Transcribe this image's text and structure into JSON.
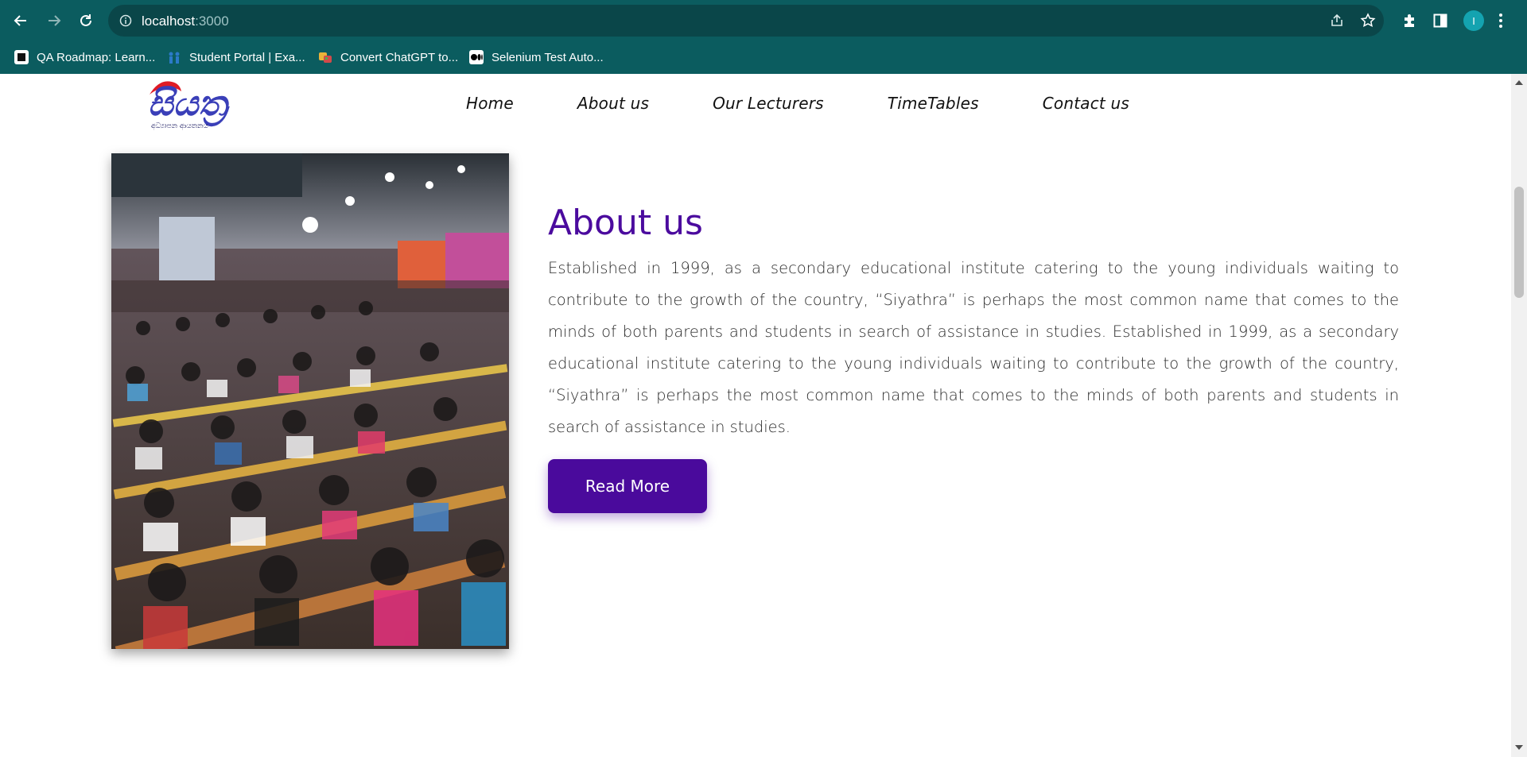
{
  "browser": {
    "url_host": "localhost",
    "url_port": ":3000",
    "profile_initial": "I",
    "bookmarks": [
      {
        "label": "QA Roadmap: Learn...",
        "icon": "roadmap-icon",
        "color": "#111111"
      },
      {
        "label": "Student Portal | Exa...",
        "icon": "students-icon",
        "color": "#1b6fb8"
      },
      {
        "label": "Convert ChatGPT to...",
        "icon": "convert-icon",
        "color": "#e9b33a"
      },
      {
        "label": "Selenium Test Auto...",
        "icon": "medium-icon",
        "color": "#000000"
      }
    ]
  },
  "site": {
    "logo_text": "සියත්‍ර",
    "logo_subtext": "අධ්‍යාපන ආයතනය",
    "nav": [
      "Home",
      "About us",
      "Our Lecturers",
      "TimeTables",
      "Contact us"
    ]
  },
  "about": {
    "title": "About us",
    "body": "Established in 1999, as a secondary educational institute catering to the young individuals waiting to contribute to the growth of the country, “Siyathra” is perhaps the most common name that comes to the minds of both parents and students in search of assistance in studies. Established in 1999, as a secondary educational institute catering to the young individuals waiting to contribute to the growth of the country, “Siyathra” is perhaps the most common name that comes to the minds of both parents and students in search of assistance in studies.",
    "button": "Read More"
  },
  "colors": {
    "chrome": "#0b5c5f",
    "accent": "#4a0a9c",
    "title": "#4b0b9e"
  }
}
